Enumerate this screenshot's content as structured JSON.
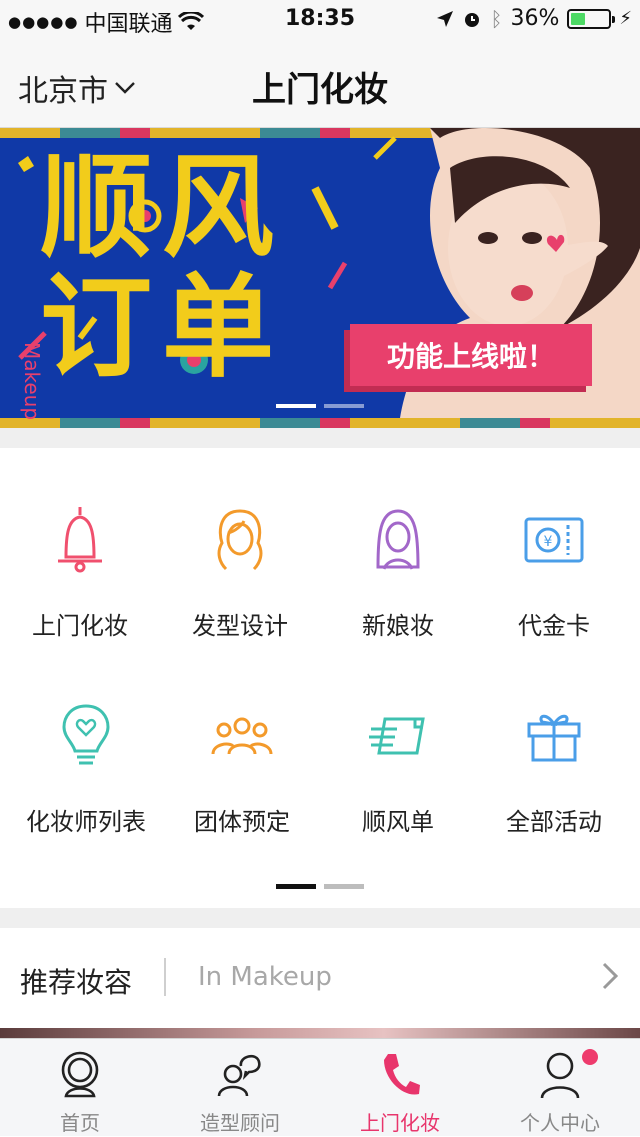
{
  "status_bar": {
    "carrier": "中国联通",
    "time": "18:35",
    "battery": "36%",
    "battery_level": 0.36
  },
  "nav": {
    "city": "北京市",
    "title": "上门化妆"
  },
  "banner": {
    "headline": "顺风订单",
    "side_text": "Makeup",
    "tag": "功能上线啦！",
    "page_count": 2,
    "active_page": 1
  },
  "services": [
    {
      "label": "上门化妆",
      "icon": "bell-icon",
      "color": "#f0506e"
    },
    {
      "label": "发型设计",
      "icon": "hair-icon",
      "color": "#f39a2b"
    },
    {
      "label": "新娘妆",
      "icon": "bride-icon",
      "color": "#a267c9"
    },
    {
      "label": "代金卡",
      "icon": "voucher-icon",
      "color": "#4a9ee8"
    },
    {
      "label": "化妆师列表",
      "icon": "lightbulb-heart-icon",
      "color": "#3fc1b0"
    },
    {
      "label": "团体预定",
      "icon": "group-icon",
      "color": "#f39a2b"
    },
    {
      "label": "顺风单",
      "icon": "document-icon",
      "color": "#3fc1b0"
    },
    {
      "label": "全部活动",
      "icon": "gift-icon",
      "color": "#4a9ee8"
    }
  ],
  "grid_pager": {
    "page_count": 2,
    "active_page": 1
  },
  "recommend": {
    "title": "推荐妆容",
    "subtitle": "In Makeup"
  },
  "tabs": [
    {
      "label": "首页",
      "icon": "mirror-icon",
      "active": false
    },
    {
      "label": "造型顾问",
      "icon": "consultant-icon",
      "active": false
    },
    {
      "label": "上门化妆",
      "icon": "phone-icon",
      "active": true
    },
    {
      "label": "个人中心",
      "icon": "person-icon",
      "active": false
    }
  ],
  "colors": {
    "accent": "#e8356c",
    "banner_bg": "#1039a7",
    "banner_yellow": "#f2cc1b",
    "tag_pink": "#e8406c"
  }
}
